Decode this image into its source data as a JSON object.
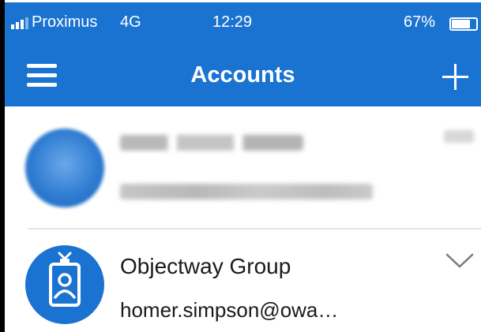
{
  "status_bar": {
    "carrier": "Proximus",
    "network": "4G",
    "time": "12:29",
    "battery": "67%"
  },
  "nav": {
    "title": "Accounts",
    "menu_icon": "hamburger-menu-icon",
    "add_icon": "plus-icon"
  },
  "accounts": [
    {
      "name": "",
      "email": "",
      "avatar": "blurred-avatar",
      "redacted": true
    },
    {
      "name": "Objectway Group",
      "email": "homer.simpson@owa…",
      "avatar": "badge-icon",
      "redacted": false
    }
  ],
  "colors": {
    "header_blue": "#1a73d1",
    "text": "#1a1a1a",
    "divider": "#e3e3e3"
  }
}
